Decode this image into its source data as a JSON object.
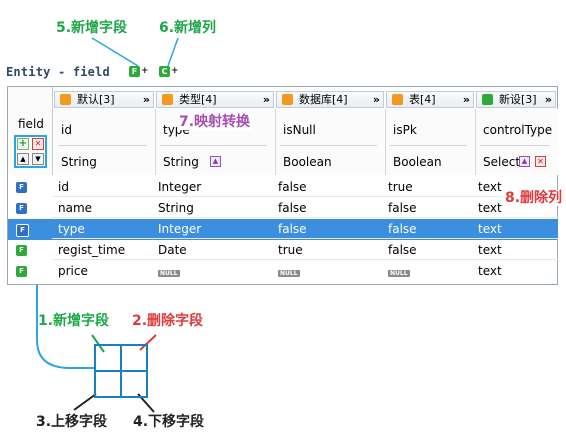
{
  "annotations": {
    "a1": "1.新增字段",
    "a2": "2.删除字段",
    "a3": "3.上移字段",
    "a4": "4.下移字段",
    "a5": "5.新增字段",
    "a6": "6.新增列",
    "a7": "7.映射转换",
    "a8": "8.删除列"
  },
  "entity_title": "Entity - field",
  "field_label": "field",
  "columns": [
    {
      "header": "默认[3]",
      "name": "id",
      "type": "String"
    },
    {
      "header": "类型[4]",
      "name": "type",
      "type": "String"
    },
    {
      "header": "数据库[4]",
      "name": "isNull",
      "type": "Boolean"
    },
    {
      "header": "表[4]",
      "name": "isPk",
      "type": "Boolean"
    },
    {
      "header": "新设[3]",
      "name": "controlType",
      "type": "Select"
    }
  ],
  "chevron": "»",
  "null_label": "NULL",
  "rows": [
    {
      "c1": "id",
      "c2": "Integer",
      "c3": "false",
      "c4": "true",
      "c5": "text"
    },
    {
      "c1": "name",
      "c2": "String",
      "c3": "false",
      "c4": "false",
      "c5": "text"
    },
    {
      "c1": "type",
      "c2": "Integer",
      "c3": "false",
      "c4": "false",
      "c5": "text"
    },
    {
      "c1": "regist_time",
      "c2": "Date",
      "c3": "true",
      "c4": "false",
      "c5": "text"
    },
    {
      "c1": "price",
      "c2": "",
      "c3": "",
      "c4": "",
      "c5": "text"
    }
  ],
  "colors": {
    "green": "#1fa64a",
    "red": "#e03a3a",
    "purple": "#a64fb0",
    "selection": "#3b8fde",
    "highlight": "#2aa6e0"
  }
}
